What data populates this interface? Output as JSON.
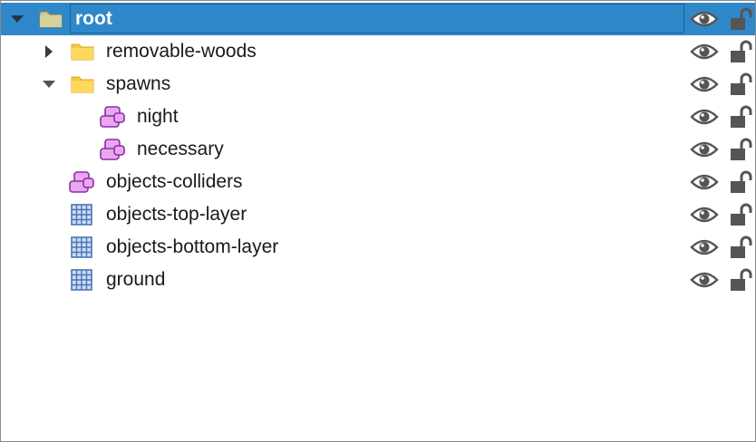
{
  "colors": {
    "selection": "#2f88c9",
    "folder": "#ffd75a",
    "object_layer": "#e8a8f0",
    "tile_layer": "#4a73b8",
    "icon_gray": "#555555"
  },
  "layers": [
    {
      "name": "root",
      "type": "group",
      "expanded": true,
      "selected": true,
      "depth": 0,
      "visible": true,
      "locked": false
    },
    {
      "name": "removable-woods",
      "type": "group",
      "expanded": false,
      "selected": false,
      "depth": 1,
      "visible": true,
      "locked": false
    },
    {
      "name": "spawns",
      "type": "group",
      "expanded": true,
      "selected": false,
      "depth": 1,
      "visible": true,
      "locked": false
    },
    {
      "name": "night",
      "type": "object-layer",
      "selected": false,
      "depth": 2,
      "visible": true,
      "locked": false
    },
    {
      "name": "necessary",
      "type": "object-layer",
      "selected": false,
      "depth": 2,
      "visible": true,
      "locked": false
    },
    {
      "name": "objects-colliders",
      "type": "object-layer",
      "selected": false,
      "depth": 1,
      "visible": true,
      "locked": false
    },
    {
      "name": "objects-top-layer",
      "type": "tile-layer",
      "selected": false,
      "depth": 1,
      "visible": true,
      "locked": false
    },
    {
      "name": "objects-bottom-layer",
      "type": "tile-layer",
      "selected": false,
      "depth": 1,
      "visible": true,
      "locked": false
    },
    {
      "name": "ground",
      "type": "tile-layer",
      "selected": false,
      "depth": 1,
      "visible": true,
      "locked": false
    }
  ]
}
